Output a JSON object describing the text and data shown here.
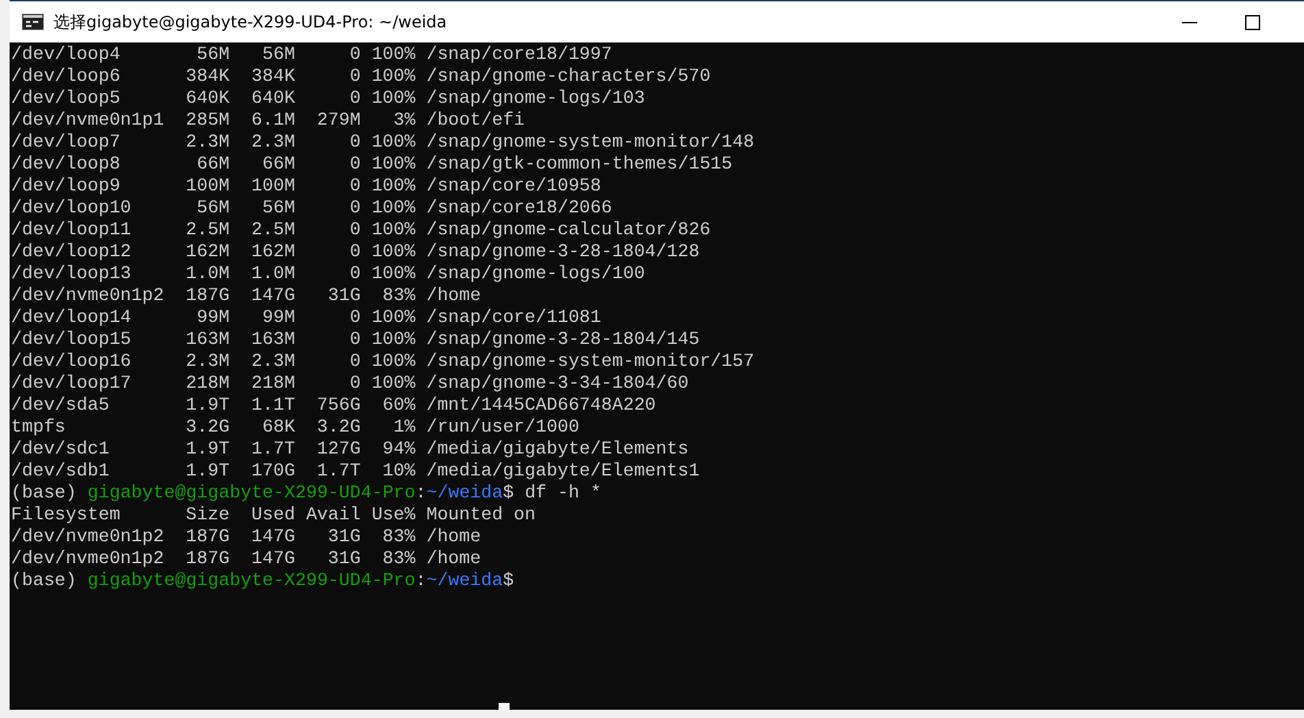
{
  "window": {
    "title": "选择gigabyte@gigabyte-X299-UD4-Pro: ~/weida"
  },
  "terminal": {
    "lines": [
      {
        "kind": "output",
        "text": "/dev/loop4       56M   56M     0 100% /snap/core18/1997"
      },
      {
        "kind": "output",
        "text": "/dev/loop6      384K  384K     0 100% /snap/gnome-characters/570"
      },
      {
        "kind": "output",
        "text": "/dev/loop5      640K  640K     0 100% /snap/gnome-logs/103"
      },
      {
        "kind": "output",
        "text": "/dev/nvme0n1p1  285M  6.1M  279M   3% /boot/efi"
      },
      {
        "kind": "output",
        "text": "/dev/loop7      2.3M  2.3M     0 100% /snap/gnome-system-monitor/148"
      },
      {
        "kind": "output",
        "text": "/dev/loop8       66M   66M     0 100% /snap/gtk-common-themes/1515"
      },
      {
        "kind": "output",
        "text": "/dev/loop9      100M  100M     0 100% /snap/core/10958"
      },
      {
        "kind": "output",
        "text": "/dev/loop10      56M   56M     0 100% /snap/core18/2066"
      },
      {
        "kind": "output",
        "text": "/dev/loop11     2.5M  2.5M     0 100% /snap/gnome-calculator/826"
      },
      {
        "kind": "output",
        "text": "/dev/loop12     162M  162M     0 100% /snap/gnome-3-28-1804/128"
      },
      {
        "kind": "output",
        "text": "/dev/loop13     1.0M  1.0M     0 100% /snap/gnome-logs/100"
      },
      {
        "kind": "output",
        "text": "/dev/nvme0n1p2  187G  147G   31G  83% /home"
      },
      {
        "kind": "output",
        "text": "/dev/loop14      99M   99M     0 100% /snap/core/11081"
      },
      {
        "kind": "output",
        "text": "/dev/loop15     163M  163M     0 100% /snap/gnome-3-28-1804/145"
      },
      {
        "kind": "output",
        "text": "/dev/loop16     2.3M  2.3M     0 100% /snap/gnome-system-monitor/157"
      },
      {
        "kind": "output",
        "text": "/dev/loop17     218M  218M     0 100% /snap/gnome-3-34-1804/60"
      },
      {
        "kind": "output",
        "text": "/dev/sda5       1.9T  1.1T  756G  60% /mnt/1445CAD66748A220"
      },
      {
        "kind": "output",
        "text": "tmpfs           3.2G   68K  3.2G   1% /run/user/1000"
      },
      {
        "kind": "output",
        "text": "/dev/sdc1       1.9T  1.7T  127G  94% /media/gigabyte/Elements"
      },
      {
        "kind": "output",
        "text": "/dev/sdb1       1.9T  170G  1.7T  10% /media/gigabyte/Elements1"
      },
      {
        "kind": "prompt",
        "env": "(base)",
        "user_host": "gigabyte@gigabyte-X299-UD4-Pro",
        "separator": ":",
        "path": "~/weida",
        "symbol": "$",
        "command": "df -h *"
      },
      {
        "kind": "output",
        "text": "Filesystem      Size  Used Avail Use% Mounted on"
      },
      {
        "kind": "output",
        "text": "/dev/nvme0n1p2  187G  147G   31G  83% /home"
      },
      {
        "kind": "output",
        "text": "/dev/nvme0n1p2  187G  147G   31G  83% /home"
      },
      {
        "kind": "prompt",
        "env": "(base)",
        "user_host": "gigabyte@gigabyte-X299-UD4-Pro",
        "separator": ":",
        "path": "~/weida",
        "symbol": "$"
      }
    ]
  }
}
